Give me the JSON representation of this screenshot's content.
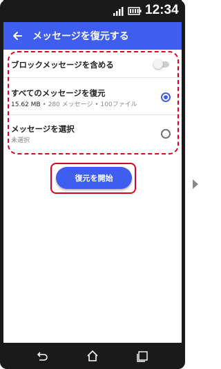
{
  "status_bar": {
    "time": "12:34",
    "icons": [
      "signal-icon",
      "battery-icon"
    ]
  },
  "app_bar": {
    "title": "メッセージを復元する",
    "back_icon": "back-arrow-icon"
  },
  "options": {
    "include_blocked": {
      "label": "ブロックメッセージを含める",
      "enabled": false
    },
    "restore_all": {
      "label": "すべてのメッセージを復元",
      "size": "15.62 MB",
      "detail": " • 280 メッセージ • 100ファイル",
      "selected": true
    },
    "select_messages": {
      "label": "メッセージを選択",
      "subtitle": "未選択",
      "selected": false
    }
  },
  "start_button": {
    "label": "復元を開始"
  },
  "nav_bar": {
    "icons": [
      "back-icon",
      "home-icon",
      "recents-icon"
    ]
  },
  "colors": {
    "accent": "#3f5ef0",
    "highlight": "#e0001a"
  }
}
